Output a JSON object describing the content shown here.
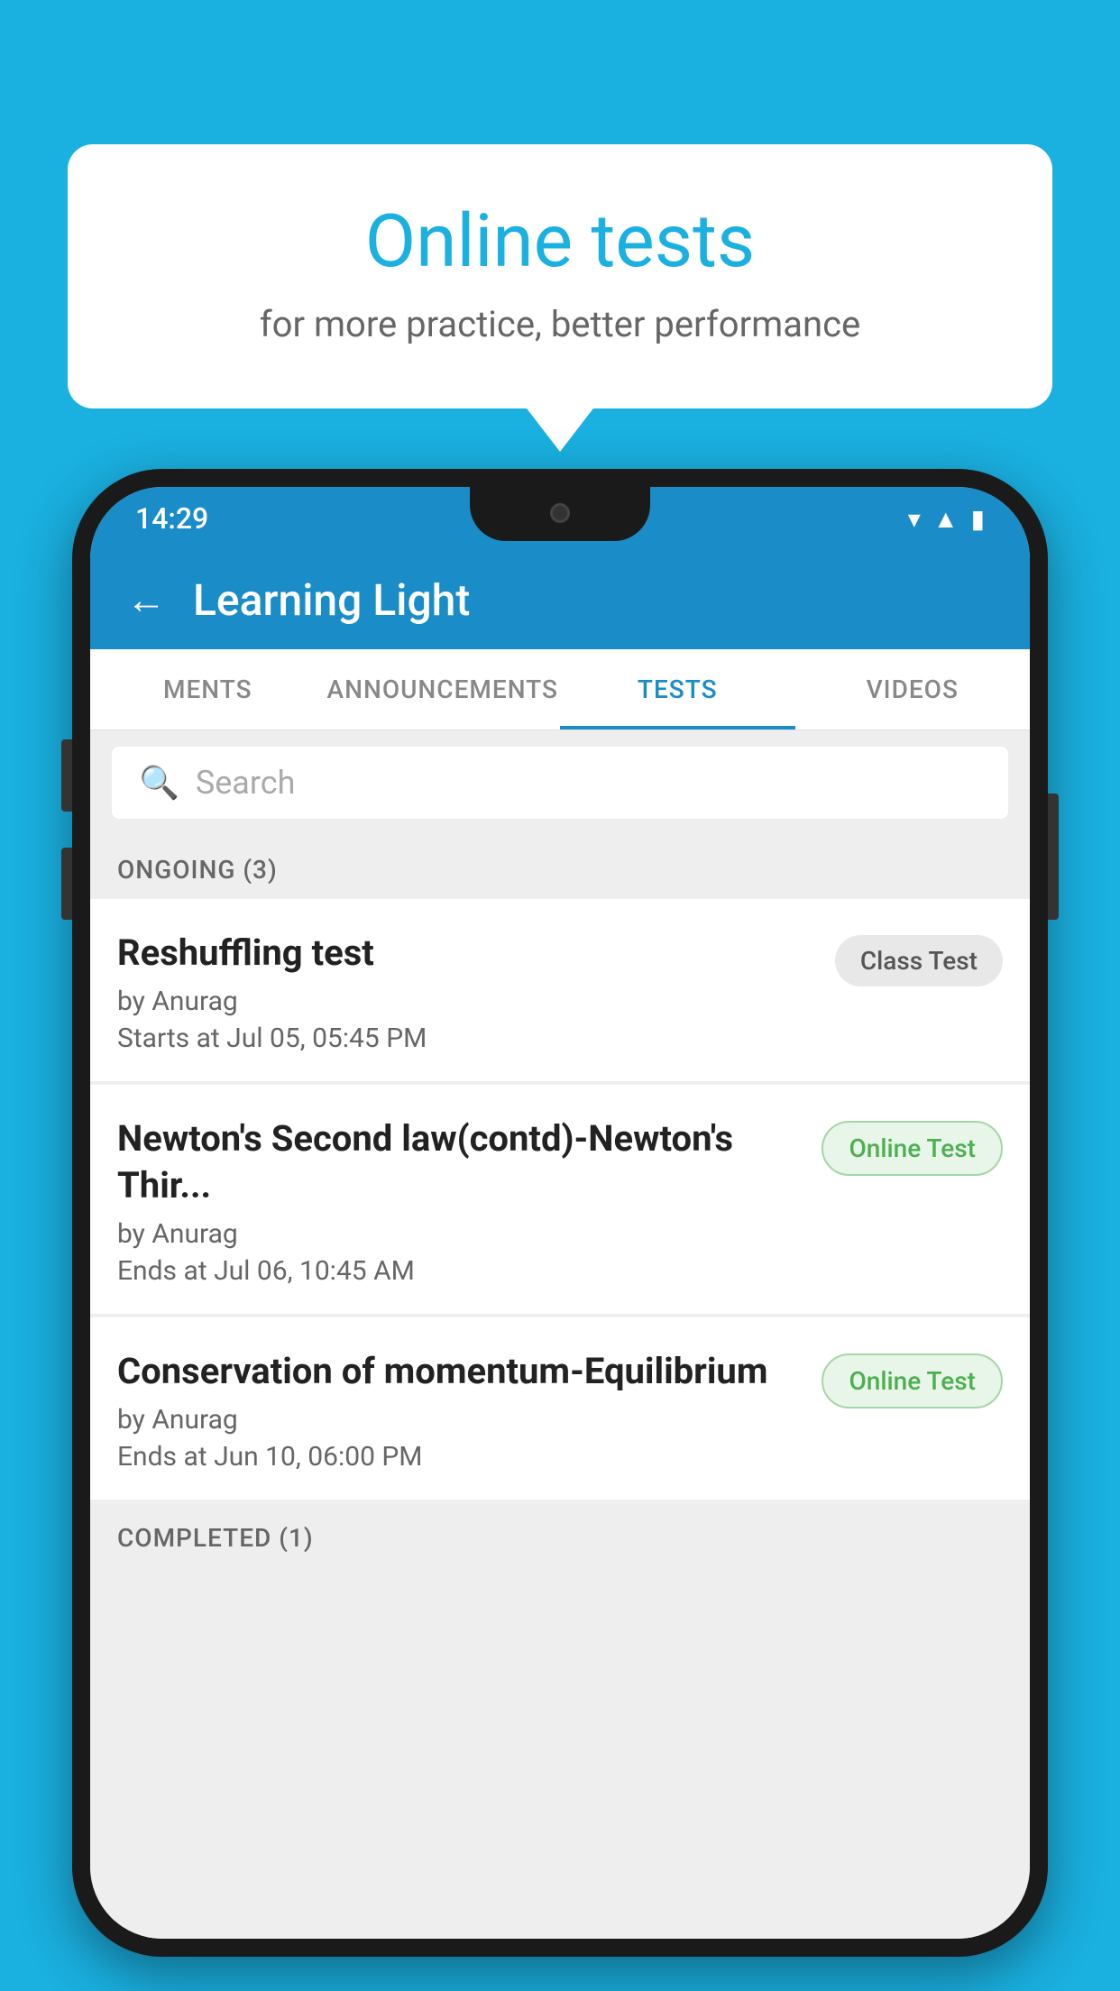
{
  "background_color": "#1ab0e0",
  "bubble": {
    "title": "Online tests",
    "subtitle": "for more practice, better performance"
  },
  "phone": {
    "status_bar": {
      "time": "14:29",
      "wifi": "▾",
      "signal": "▾",
      "battery": "▮"
    },
    "app_bar": {
      "title": "Learning Light",
      "back_label": "←"
    },
    "tabs": [
      {
        "label": "MENTS",
        "active": false
      },
      {
        "label": "ANNOUNCEMENTS",
        "active": false
      },
      {
        "label": "TESTS",
        "active": true
      },
      {
        "label": "VIDEOS",
        "active": false
      }
    ],
    "search": {
      "placeholder": "Search"
    },
    "sections": [
      {
        "heading": "ONGOING (3)",
        "tests": [
          {
            "name": "Reshuffling test",
            "author": "by Anurag",
            "time_label": "Starts at",
            "time_value": "Jul 05, 05:45 PM",
            "badge": "Class Test",
            "badge_type": "class"
          },
          {
            "name": "Newton's Second law(contd)-Newton's Thir...",
            "author": "by Anurag",
            "time_label": "Ends at",
            "time_value": "Jul 06, 10:45 AM",
            "badge": "Online Test",
            "badge_type": "online"
          },
          {
            "name": "Conservation of momentum-Equilibrium",
            "author": "by Anurag",
            "time_label": "Ends at",
            "time_value": "Jun 10, 06:00 PM",
            "badge": "Online Test",
            "badge_type": "online"
          }
        ]
      },
      {
        "heading": "COMPLETED (1)"
      }
    ]
  }
}
